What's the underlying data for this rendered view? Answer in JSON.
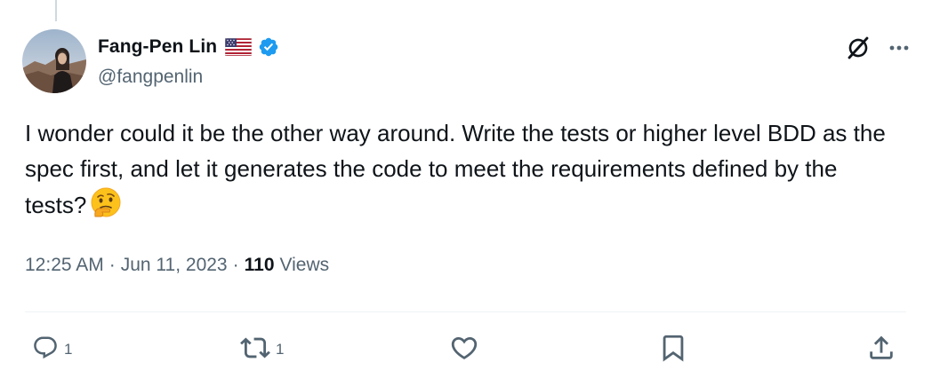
{
  "author": {
    "display_name": "Fang-Pen Lin",
    "handle": "@fangpenlin",
    "flag": "us-flag-icon",
    "verified": true
  },
  "tweet": {
    "text": "I wonder could it be the other way around. Write the tests or higher level BDD as the spec first, and let it generates the code to meet the requirements defined by the tests?",
    "emoji": "🤔"
  },
  "meta": {
    "time": "12:25 AM",
    "separator": "·",
    "date": "Jun 11, 2023",
    "views_count": "110",
    "views_label": "Views"
  },
  "actions": {
    "reply_count": "1",
    "retweet_count": "1"
  },
  "colors": {
    "text": "#0f1419",
    "secondary": "#536471",
    "verified": "#1d9bf0",
    "divider": "#eff3f4"
  }
}
